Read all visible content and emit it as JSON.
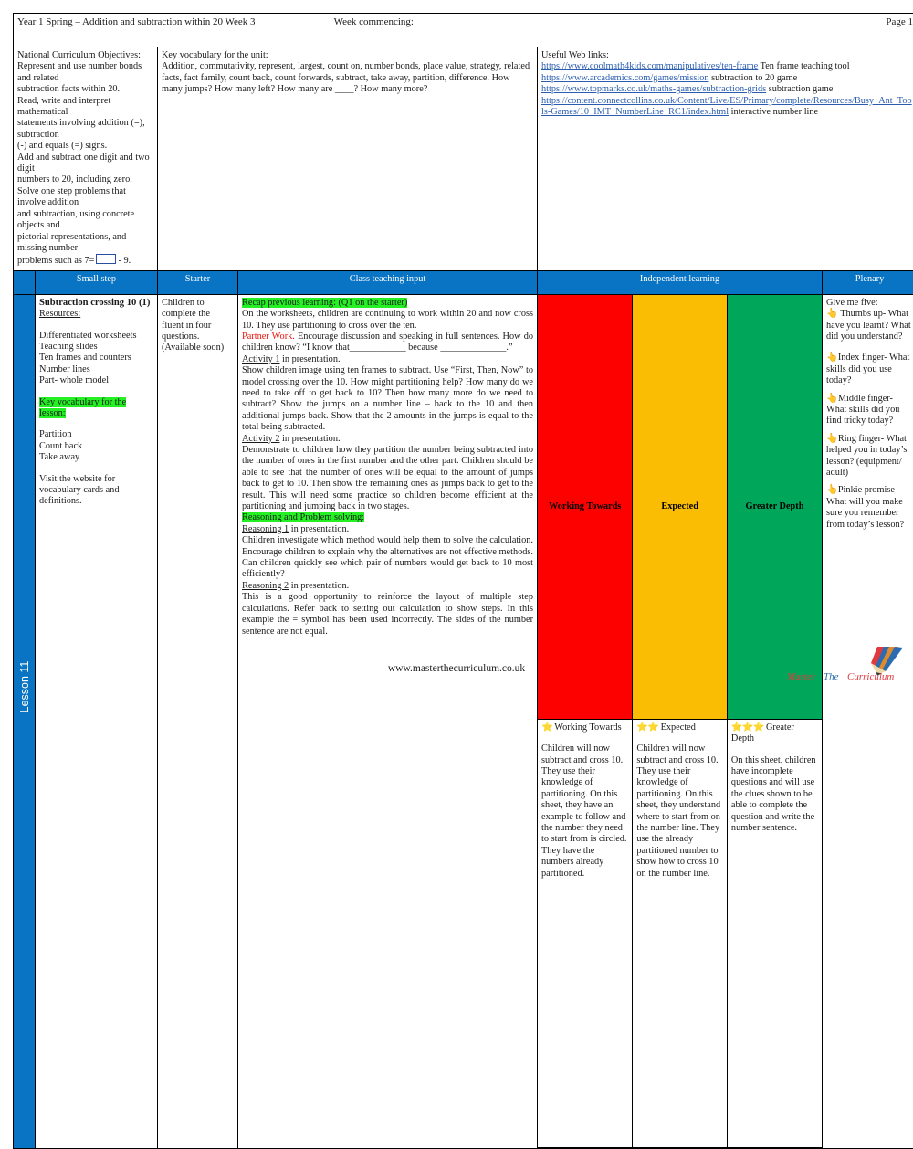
{
  "header": {
    "title": "Year 1 Spring – Addition and subtraction within 20 Week 3",
    "week_commencing": "Week commencing: ______________________________________",
    "page": "Page 1"
  },
  "info": {
    "nc_label": "National Curriculum Objectives:",
    "nc_lines": [
      "Represent and use number bonds and related",
      "subtraction facts within 20.",
      "Read, write and interpret mathematical",
      "statements involving addition (=), subtraction",
      "(-) and equals (=) signs.",
      "Add and subtract one digit and two digit",
      "numbers to 20, including zero.",
      "Solve one step problems that involve addition",
      "and subtraction, using concrete objects and",
      "pictorial representations, and missing number"
    ],
    "nc_last_prefix": "problems such as 7=",
    "nc_last_suffix": "- 9.",
    "vocab_label": "Key vocabulary for the unit:",
    "vocab_text": "Addition, commutativity, represent, largest, count on, number bonds, place value, strategy, related facts, fact family, count back, count forwards, subtract, take away, partition, difference. How many jumps? How many left? How many are ____? How many more?",
    "links_label": "Useful Web links:",
    "links": [
      {
        "url": "https://www.coolmath4kids.com/manipulatives/ten-frame",
        "suffix": " Ten frame teaching tool"
      },
      {
        "url": "https://www.arcademics.com/games/mission",
        "suffix": " subtraction to 20 game"
      },
      {
        "url": "https://www.topmarks.co.uk/maths-games/subtraction-grids",
        "suffix": " subtraction game"
      },
      {
        "url": "https://content.connectcollins.co.uk/Content/Live/ES/Primary/complete/Resources/Busy_Ant_Tools-Games/10_IMT_NumberLine_RC1/index.html",
        "suffix": " interactive number line"
      }
    ]
  },
  "columns": {
    "small_step": "Small step",
    "starter": "Starter",
    "class_teaching": "Class teaching input",
    "independent": "Independent learning",
    "plenary": "Plenary"
  },
  "lesson_label": "Lesson 11",
  "small_step": {
    "title": "Subtraction crossing 10 (1)",
    "resources_label": "Resources:",
    "resources": [
      "Differentiated worksheets",
      "Teaching slides",
      "Ten frames and counters",
      "Number lines",
      "Part- whole model"
    ],
    "vocab_heading": "Key vocabulary for the lesson:",
    "vocab_words": [
      "Partition",
      "Count back",
      "Take away"
    ],
    "website_note": "Visit the website for vocabulary cards and definitions."
  },
  "starter": {
    "text": "Children to complete the fluent in four questions. (Available soon)"
  },
  "teaching": {
    "recap_heading": "Recap previous learning: (Q1 on the starter)",
    "recap_text": "On the worksheets, children are continuing to work within 20 and now cross 10. They use partitioning to cross over the ten.",
    "partner_label": "Partner Work.",
    "partner_text": " Encourage discussion and speaking in full sentences. How do children know?  “I know that____________ because ______________.”",
    "activity1_label": "Activity 1",
    "activity1_suffix": " in presentation.",
    "activity1_text": "Show children image using ten frames to subtract. Use “First, Then, Now” to model crossing over the 10. How might partitioning help? How many do we need to take off to get back to 10? Then how many more do we need to subtract? Show the jumps on a number line – back to the 10 and then additional jumps back. Show that the 2 amounts in the jumps is equal to the total being subtracted.",
    "activity2_label": "Activity 2",
    "activity2_suffix": " in presentation.",
    "activity2_text": "Demonstrate to children how they partition the number being subtracted into the number of ones in the first number and the other part.  Children should be able to see that the number of ones will be equal to the amount of jumps back to get to 10. Then show the remaining ones as jumps back to get to the result. This will need some practice so children become efficient at the partitioning and jumping back in two stages.",
    "rps_heading": "Reasoning and Problem solving:",
    "reasoning1_label": "Reasoning 1",
    "reasoning1_suffix": " in presentation.",
    "reasoning1_text": "Children investigate which method would help them to solve the calculation. Encourage children to explain why the alternatives are not effective methods. Can children quickly see which pair of numbers would get back to 10 most efficiently?",
    "reasoning2_label": "Reasoning 2",
    "reasoning2_suffix": " in presentation.",
    "reasoning2_text": "This is a good opportunity to reinforce the layout of multiple step calculations. Refer back to setting out calculation to show steps. In this example the = symbol has been used incorrectly. The sides of the number sentence are not equal."
  },
  "independent": {
    "working_towards": {
      "badge": "Working Towards",
      "stars": "⭐",
      "heading": " Working Towards",
      "text": "Children will now subtract and cross 10. They use their knowledge of partitioning. On this sheet, they have an example to follow and the number they need to start from is circled. They have the numbers already partitioned."
    },
    "expected": {
      "badge": "Expected",
      "stars": "⭐⭐",
      "heading": " Expected",
      "text": "Children will now subtract and cross 10. They use their knowledge of partitioning. On this sheet, they understand where to start from on the number line. They use the already partitioned number to show how to cross 10 on the number line."
    },
    "greater_depth": {
      "badge": "Greater Depth",
      "stars": "⭐⭐⭐",
      "heading": " Greater Depth",
      "text": "On this sheet, children have incomplete questions and will use the clues shown to be able to complete the question and write the number sentence."
    }
  },
  "plenary": {
    "intro": "Give me five:",
    "items": [
      {
        "icon": "👆",
        "text": " Thumbs up- What have you learnt? What did you understand?"
      },
      {
        "icon": "👆",
        "text": "Index finger- What skills did you use today?"
      },
      {
        "icon": "👆",
        "text": "Middle finger- What skills did you find tricky today?"
      },
      {
        "icon": "👆",
        "text": "Ring finger- What helped you in today’s lesson? (equipment/ adult)"
      },
      {
        "icon": "👆",
        "text": "Pinkie promise- What will you make sure you remember from today’s lesson?"
      }
    ]
  },
  "footer": {
    "website": "www.masterthecurriculum.co.uk",
    "logo_words": [
      "Master",
      "The",
      "Curriculum"
    ],
    "logo_colors": [
      "#e03a3e",
      "#2b6cb0",
      "#e08a2e"
    ]
  }
}
